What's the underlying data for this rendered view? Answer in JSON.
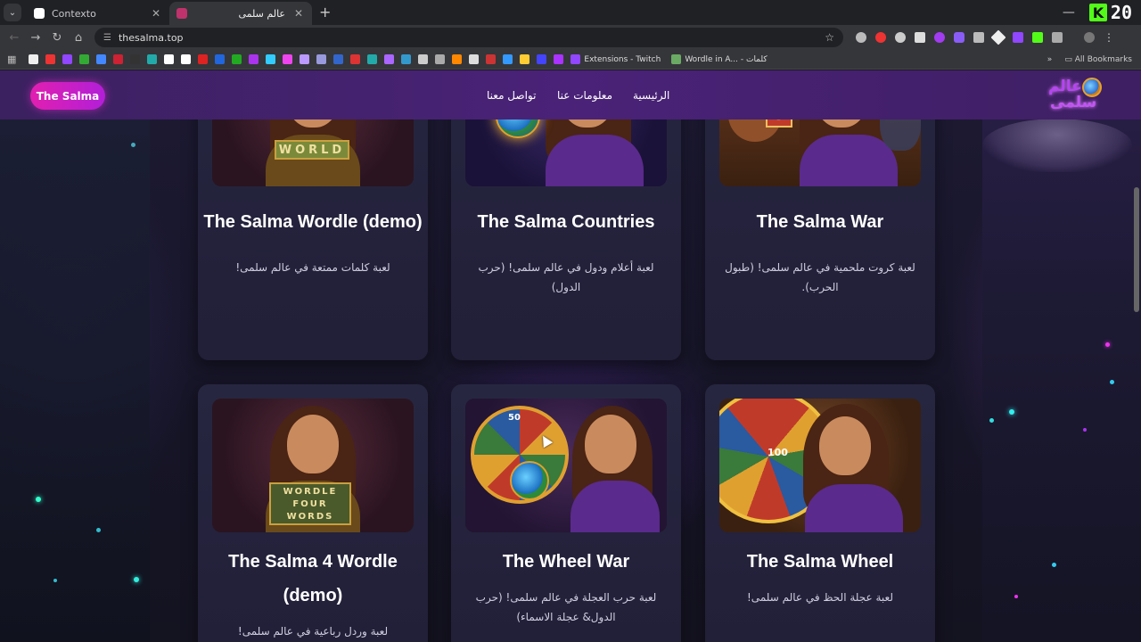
{
  "browser": {
    "tabs": [
      {
        "title": "Contexto",
        "color": "#ffffff"
      },
      {
        "title": "عالم سلمى",
        "color": "#c0326b"
      }
    ],
    "new_tab": "+",
    "url": "thesalma.top",
    "kick_counter": "20",
    "bookmarks": [
      {
        "label": "Extensions - Twitch",
        "color": "#9146ff"
      },
      {
        "label": "Wordle in A... - كلمات",
        "color": "#6aaa64"
      }
    ],
    "all_bookmarks": "All Bookmarks"
  },
  "site": {
    "brand_button": "The Salma",
    "nav": [
      "الرئيسية",
      "معلومات عنا",
      "تواصل معنا"
    ],
    "logo_line1": "عالم",
    "logo_line2": "سلمى"
  },
  "games": [
    {
      "title": "The Salma Wordle (demo)",
      "desc": "لعبة كلمات ممتعة في عالم سلمى!",
      "thumb_text": "WORLD"
    },
    {
      "title": "The Salma Countries",
      "desc": "لعبة أعلام ودول في عالم سلمى! (حرب الدول)"
    },
    {
      "title": "The Salma War",
      "desc": "لعبة كروت ملحمية في عالم سلمى! (طبول الحرب).",
      "thumb_text": "S"
    },
    {
      "title": "The Salma 4 Wordle (demo)",
      "desc": "لعبة وردل رباعية في عالم سلمى!",
      "thumb_text": "WORDLE FOUR WORDS"
    },
    {
      "title": "The Wheel War",
      "desc": "لعبة حرب العجلة في عالم سلمى! (حرب الدول& عجلة الاسماء)",
      "thumb_text": "50"
    },
    {
      "title": "The Salma Wheel",
      "desc": "لعبة عجلة الحظ في عالم سلمى!",
      "thumb_text": "100"
    }
  ]
}
